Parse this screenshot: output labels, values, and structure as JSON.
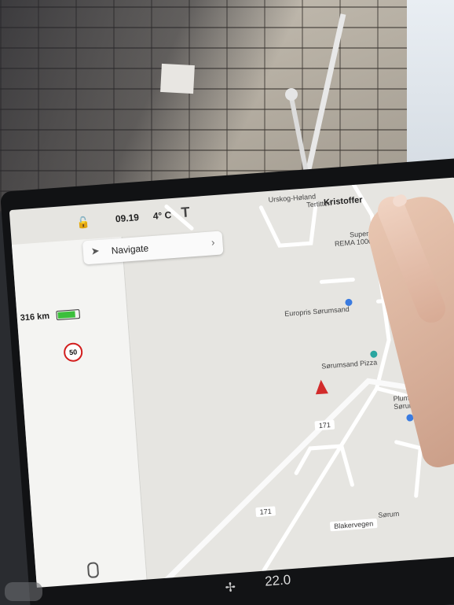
{
  "status": {
    "time": "09.19",
    "temperature": "4° C",
    "user": "Kristoffer",
    "range": "316 km",
    "speed_limit": "50"
  },
  "navigate": {
    "label": "Navigate"
  },
  "map_labels": {
    "orskog": "Urskog-Høland",
    "tertitten": "Tertitten",
    "supermarket": "Supermarket",
    "rema": "REMA 1000 Sørumsand",
    "europris": "Europris Sørumsand",
    "pizza": "Sørumsand Pizza",
    "plumbing": "Plumbing supply sto",
    "sorumsand": "Sørumsand",
    "road_171a": "171",
    "road_171b": "171",
    "blakervegen": "Blakervegen",
    "sorum": "Sørum"
  },
  "climate": {
    "temperature": "22.0"
  },
  "icons": [
    "lock-icon",
    "tesla-logo-icon",
    "navigate-arrow-icon",
    "chevron-right-icon",
    "battery-icon",
    "microphone-icon",
    "fan-icon",
    "user-icon",
    "home-icon",
    "seat-heater-icon",
    "defrost-icon",
    "volume-icon"
  ]
}
